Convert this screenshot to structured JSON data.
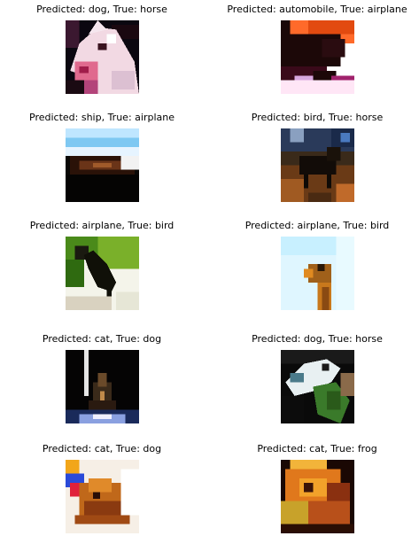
{
  "figure": {
    "panels": [
      {
        "title": "Predicted: dog, True: horse",
        "subject": "horse head close-up, dark background"
      },
      {
        "title": "Predicted: automobile, True: airplane",
        "subject": "dark aircraft shape on orange and white background"
      },
      {
        "title": "Predicted: ship, True: airplane",
        "subject": "dark object under blue sky"
      },
      {
        "title": "Predicted: bird, True: horse",
        "subject": "dark horse in brown field"
      },
      {
        "title": "Predicted: airplane, True: bird",
        "subject": "black bird on green and white background"
      },
      {
        "title": "Predicted: airplane, True: bird",
        "subject": "brown bird head against pale sky"
      },
      {
        "title": "Predicted: cat, True: dog",
        "subject": "dark scene with small figure"
      },
      {
        "title": "Predicted: dog, True: horse",
        "subject": "white horse head with green"
      },
      {
        "title": "Predicted: cat, True: dog",
        "subject": "brown dog with red blue fragments"
      },
      {
        "title": "Predicted: cat, True: frog",
        "subject": "orange animal close-up"
      }
    ]
  }
}
